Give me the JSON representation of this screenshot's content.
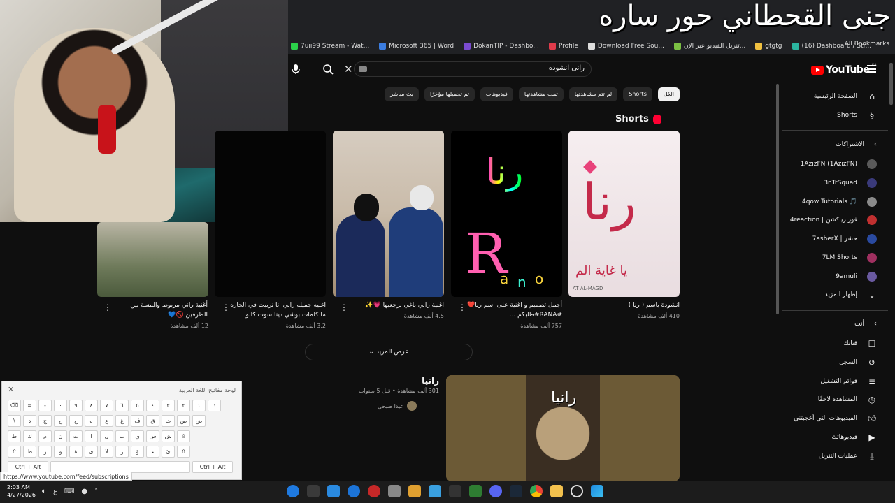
{
  "overlay": {
    "title": "جنى القحطاني  حور ساره"
  },
  "bookmarks": [
    {
      "label": "7uii99 Stream - Wat...",
      "color": "#2bd14a"
    },
    {
      "label": "Microsoft 365 | Word",
      "color": "#3b7de0"
    },
    {
      "label": "DokanTIP - Dashbo...",
      "color": "#7a4bd0"
    },
    {
      "label": "Profile",
      "color": "#e03b4b"
    },
    {
      "label": "Download Free Sou...",
      "color": "#dddddd"
    },
    {
      "label": "تنزيل الفيديو عبر الإن...",
      "color": "#7bc043"
    },
    {
      "label": "gtgtg",
      "color": "#f0c040"
    },
    {
      "label": "(16) Dashboard / Str...",
      "color": "#2bb5a0"
    }
  ],
  "all_bookmarks": "All Bookmarks",
  "search": {
    "query": "رانى انشوده"
  },
  "logo": {
    "text": "YouTube",
    "region": "SA"
  },
  "chips": [
    "الكل",
    "Shorts",
    "لم تتم مشاهدتها",
    "تمت مشاهدتها",
    "فيديوهات",
    "تم تحميلها مؤخرًا",
    "بث مباشر"
  ],
  "shorts_heading": "Shorts",
  "shorts": [
    {
      "title": "انشودة باسم ( رنا )",
      "views": "410 ألف مشاهدة"
    },
    {
      "title": "أجمل تصميم و اغنية على اسم رنا❤️ #RANA#طلبكم ...",
      "views": "757 ألف مشاهدة"
    },
    {
      "title": "اغنية راني باغي نرجعيها 💗✨",
      "views": "4.5 ألف مشاهدة"
    },
    {
      "title": "اغنيه جميله راني انا نرببت في الحاره ما كلمات بوشي دينا سوت كابو",
      "views": "3.2 ألف مشاهدة"
    },
    {
      "title": "أغنية راني مربوط والمسة بين الطرفين 🚫💙",
      "views": "12 ألف مشاهدة"
    }
  ],
  "show_more": "عرض المزيد",
  "video": {
    "title": "رانيا",
    "meta": "301 ألف مشاهدة • قبل 5 سنوات",
    "channel": "عيدا صبحي",
    "overlay_text": "رانيا"
  },
  "sidebar": {
    "home": "الصفحة الرئيسية",
    "shorts": "Shorts",
    "subscriptions_header": "الاشتراكات",
    "subscriptions": [
      {
        "name": "1AzizFN (1AzizFN)",
        "color": "#5a5a5a"
      },
      {
        "name": "3nTrSquad",
        "color": "#3a3a7a"
      },
      {
        "name": "4qow Tutorials 🎵",
        "color": "#8a8a8a"
      },
      {
        "name": "4reaction | فور رياكشن",
        "color": "#c03030"
      },
      {
        "name": "7asherX | حشر",
        "color": "#2a4aa0"
      },
      {
        "name": "7LM Shorts",
        "color": "#a03060"
      },
      {
        "name": "9amuli",
        "color": "#6a5aa0"
      }
    ],
    "show_more": "إظهار المزيد",
    "you_header": "أنت",
    "you_items": [
      {
        "label": "قناتك",
        "icon": "account-icon"
      },
      {
        "label": "السجل",
        "icon": "history-icon"
      },
      {
        "label": "قوائم التشغيل",
        "icon": "playlists-icon"
      },
      {
        "label": "المشاهدة لاحقًا",
        "icon": "watch-later-icon"
      },
      {
        "label": "الفيديوهات التي أعجبتني",
        "icon": "like-icon"
      },
      {
        "label": "فيديوهاتك",
        "icon": "your-videos-icon"
      },
      {
        "label": "عمليات التنزيل",
        "icon": "download-icon"
      }
    ]
  },
  "keyboard": {
    "title": "لوحة مفاتيح اللغة العربية",
    "rows": [
      [
        "⌫",
        "=",
        "-",
        "٠",
        "٩",
        "٨",
        "٧",
        "٦",
        "٥",
        "٤",
        "٣",
        "٢",
        "١",
        "ذ"
      ],
      [
        "\\",
        "د",
        "ج",
        "ح",
        "خ",
        "ه",
        "ع",
        "غ",
        "ف",
        "ق",
        "ث",
        "ص",
        "ض"
      ],
      [
        "ط",
        "ك",
        "م",
        "ن",
        "ت",
        "ا",
        "ل",
        "ب",
        "ي",
        "س",
        "ش",
        "⇪"
      ],
      [
        "⇧",
        "ظ",
        "ز",
        "و",
        "ة",
        "ى",
        "لا",
        "ر",
        "ؤ",
        "ء",
        "ئ",
        "⇧"
      ]
    ],
    "ctrl_alt": "Ctrl + Alt"
  },
  "status_url": "https://www.youtube.com/feed/subscriptions",
  "taskbar": {
    "time": "2:03 AM",
    "date": "4/27/2026",
    "lang": "ع"
  }
}
